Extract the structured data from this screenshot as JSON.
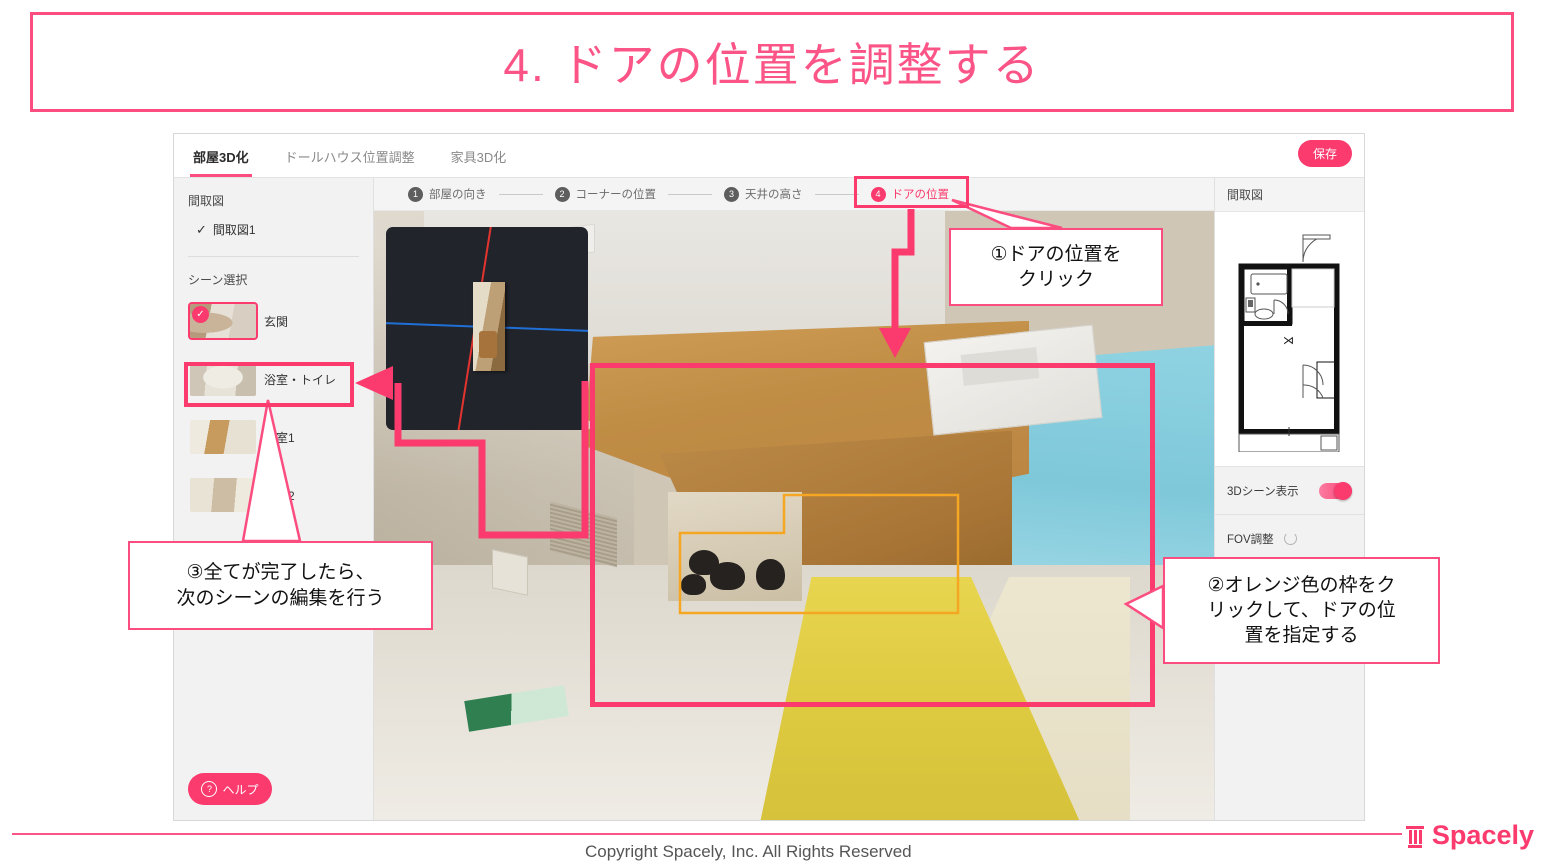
{
  "slide": {
    "title": "4. ドアの位置を調整する",
    "footer_copyright": "Copyright Spacely, Inc. All Rights Reserved",
    "logo_text": "Spacely",
    "logo_icon": "pillar-icon"
  },
  "colors": {
    "accent_pink": "#fb3a6e",
    "title_pink": "#fb5487",
    "orange_outline": "#f5a623",
    "axis_red": "#e3342f",
    "axis_blue": "#1f6fd6"
  },
  "app": {
    "tabs": [
      {
        "label": "部屋3D化",
        "active": true
      },
      {
        "label": "ドールハウス位置調整",
        "active": false
      },
      {
        "label": "家具3D化",
        "active": false
      }
    ],
    "save_label": "保存",
    "sidebar": {
      "plan_label": "間取図",
      "plan_items": [
        {
          "label": "間取図1",
          "checked": true,
          "check_icon": "check-icon"
        }
      ],
      "scene_label": "シーン選択",
      "scenes": [
        {
          "label": "玄関",
          "badge": "check-badge",
          "selected": true
        },
        {
          "label": "浴室・トイレ",
          "badge": "",
          "selected": false
        },
        {
          "label": "洋室1",
          "badge": "",
          "selected": false
        },
        {
          "label": "洋室2",
          "badge": "",
          "selected": false
        }
      ],
      "help_label": "ヘルプ",
      "help_icon": "question-circle-icon"
    },
    "steps": [
      {
        "num": "1",
        "label": "部屋の向き",
        "active": false
      },
      {
        "num": "2",
        "label": "コーナーの位置",
        "active": false
      },
      {
        "num": "3",
        "label": "天井の高さ",
        "active": false
      },
      {
        "num": "4",
        "label": "ドアの位置",
        "active": true
      }
    ],
    "right_panel": {
      "header": "間取図",
      "floorplan_icon": "floorplan-diagram",
      "scene3d_label": "3Dシーン表示",
      "scene3d_on": true,
      "fov_label": "FOV調整",
      "fov_icon": "loading-spinner-icon"
    }
  },
  "annotations": {
    "callout1": "①ドアの位置を\nクリック",
    "callout2": "②オレンジ色の枠をク\nリックして、ドアの位\n置を指定する",
    "callout3": "③全てが完了したら、\n次のシーンの編集を行う"
  }
}
